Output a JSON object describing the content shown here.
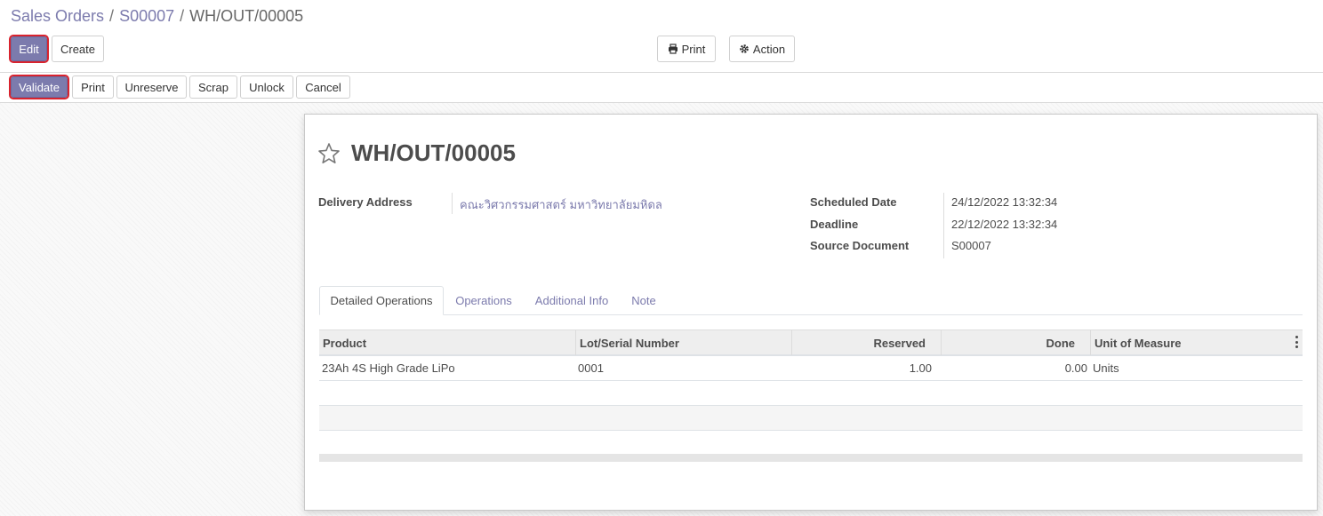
{
  "breadcrumb": {
    "items": [
      "Sales Orders",
      "S00007"
    ],
    "active": "WH/OUT/00005",
    "separator": "/"
  },
  "toolbar": {
    "edit_label": "Edit",
    "create_label": "Create",
    "print_label": "Print",
    "action_label": "Action"
  },
  "statusbar": {
    "validate_label": "Validate",
    "print_label": "Print",
    "unreserve_label": "Unreserve",
    "scrap_label": "Scrap",
    "unlock_label": "Unlock",
    "cancel_label": "Cancel"
  },
  "record": {
    "title": "WH/OUT/00005",
    "delivery_address_label": "Delivery Address",
    "delivery_address": "คณะวิศวกรรมศาสตร์ มหาวิทยาลัยมหิดล",
    "scheduled_date_label": "Scheduled Date",
    "scheduled_date": "24/12/2022 13:32:34",
    "deadline_label": "Deadline",
    "deadline": "22/12/2022 13:32:34",
    "source_document_label": "Source Document",
    "source_document": "S00007"
  },
  "tabs": [
    {
      "label": "Detailed Operations",
      "active": true
    },
    {
      "label": "Operations",
      "active": false
    },
    {
      "label": "Additional Info",
      "active": false
    },
    {
      "label": "Note",
      "active": false
    }
  ],
  "table": {
    "columns": [
      "Product",
      "Lot/Serial Number",
      "Reserved",
      "Done",
      "Unit of Measure"
    ],
    "rows": [
      {
        "product": "23Ah 4S High Grade LiPo",
        "lot": "0001",
        "reserved": "1.00",
        "done": "0.00",
        "uom": "Units"
      }
    ]
  },
  "colors": {
    "primary": "#7c7bad",
    "highlight": "#d9232e"
  },
  "icons": {
    "print": "printer-icon",
    "action": "gear-icon",
    "star": "star-outline-icon",
    "column_options": "kebab-icon"
  }
}
